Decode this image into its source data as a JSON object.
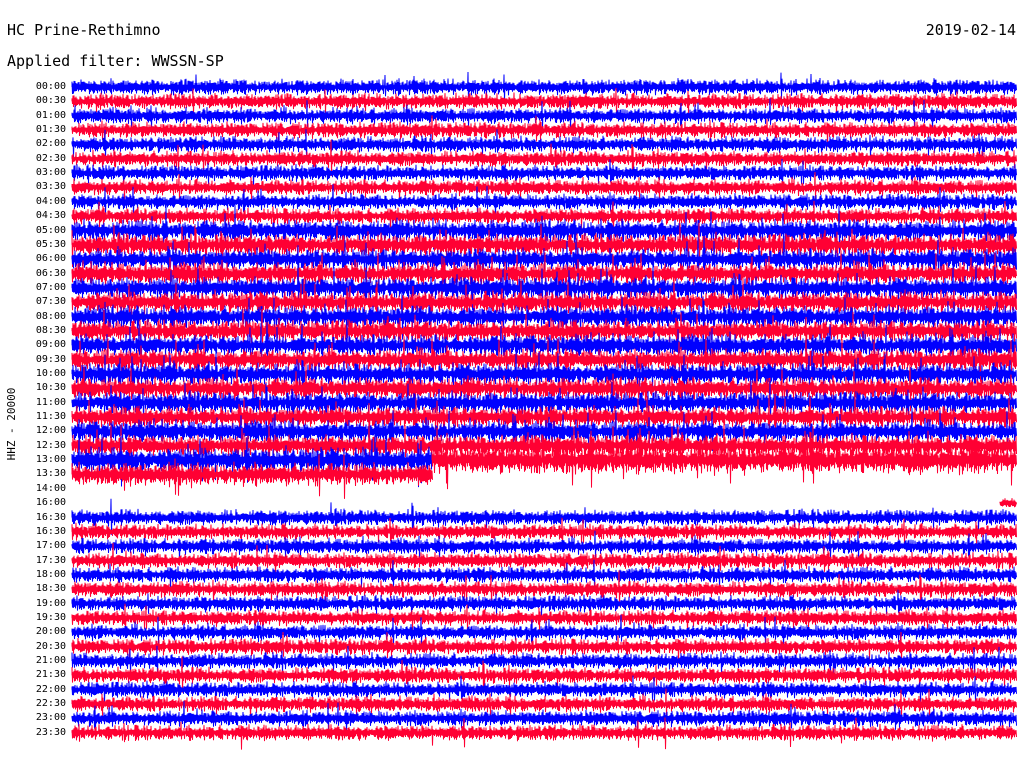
{
  "header": {
    "station": "HC Prine-Rethimno",
    "date": "2019-02-14",
    "filter": "Applied filter: WWSSN-SP"
  },
  "colors": {
    "trace_a": "#0000ff",
    "trace_b": "#ff0033",
    "background": "#ffffff",
    "text": "#000000"
  },
  "chart_data": {
    "type": "line",
    "title": "HC Prine-Rethimno",
    "ylabel": "HHZ - 20000",
    "row_labels": [
      "00:00",
      "00:30",
      "01:00",
      "01:30",
      "02:00",
      "02:30",
      "03:00",
      "03:30",
      "04:00",
      "04:30",
      "05:00",
      "05:30",
      "06:00",
      "06:30",
      "07:00",
      "07:30",
      "08:00",
      "08:30",
      "09:00",
      "09:30",
      "10:00",
      "10:30",
      "11:00",
      "11:30",
      "12:00",
      "12:30",
      "13:00",
      "13:30",
      "14:00",
      "16:00",
      "16:30",
      "16:30",
      "17:00",
      "17:30",
      "18:00",
      "18:30",
      "19:00",
      "19:30",
      "20:00",
      "20:30",
      "21:00",
      "21:30",
      "22:00",
      "22:30",
      "23:00",
      "23:30"
    ],
    "trace_colors": [
      "blue",
      "red"
    ],
    "missing_data_gap": {
      "start": "14:00",
      "end": "16:30"
    }
  }
}
